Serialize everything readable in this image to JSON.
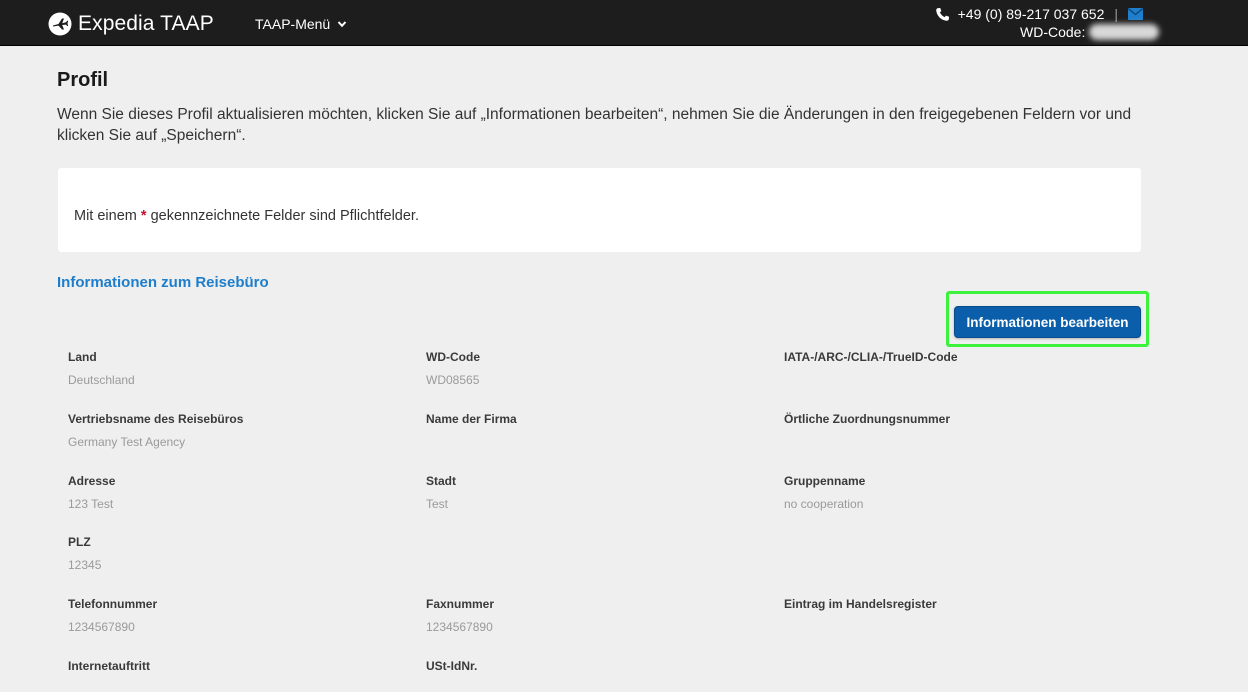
{
  "header": {
    "brand": "Expedia TAAP",
    "menu_label": "TAAP-Menü",
    "phone": "+49 (0) 89-217 037 652",
    "separator": "|",
    "wd_code_label": "WD-Code:"
  },
  "page": {
    "title": "Profil",
    "intro": "Wenn Sie dieses Profil aktualisieren möchten, klicken Sie auf „Informationen bearbeiten“, nehmen Sie die Änderungen in den freigegebenen Feldern vor und klicken Sie auf „Speichern“.",
    "notice_before": "Mit einem ",
    "notice_star": "*",
    "notice_after": " gekennzeichnete Felder sind Pflichtfelder.",
    "section_title": "Informationen zum Reisebüro",
    "edit_button": "Informationen bearbeiten"
  },
  "fields": {
    "land": {
      "label": "Land",
      "value": "Deutschland"
    },
    "wd_code": {
      "label": "WD-Code",
      "value": "WD08565"
    },
    "iata": {
      "label": "IATA-/ARC-/CLIA-/TrueID-Code",
      "value": ""
    },
    "vertriebsname": {
      "label": "Vertriebsname des Reisebüros",
      "value": "Germany Test Agency"
    },
    "firma": {
      "label": "Name der Firma",
      "value": ""
    },
    "zuordnung": {
      "label": "Örtliche Zuordnungsnummer",
      "value": ""
    },
    "adresse": {
      "label": "Adresse",
      "value": "123 Test"
    },
    "stadt": {
      "label": "Stadt",
      "value": "Test"
    },
    "gruppe": {
      "label": "Gruppenname",
      "value": "no cooperation"
    },
    "plz": {
      "label": "PLZ",
      "value": "12345"
    },
    "telefon": {
      "label": "Telefonnummer",
      "value": "1234567890"
    },
    "fax": {
      "label": "Faxnummer",
      "value": "1234567890"
    },
    "handelsregister": {
      "label": "Eintrag im Handelsregister",
      "value": ""
    },
    "internet": {
      "label": "Internetauftritt",
      "value": ""
    },
    "ust": {
      "label": "USt-IdNr.",
      "value": ""
    }
  },
  "colors": {
    "header_bg": "#1d1d1d",
    "page_bg": "#efefef",
    "link_blue": "#1e7ecb",
    "button_blue": "#0a5eaa",
    "highlight_green": "#3df23d",
    "required_red": "#c8102e"
  },
  "icons": {
    "logo": "expedia-plane-icon",
    "menu": "chevron-down-icon",
    "phone": "phone-icon",
    "mail": "mail-icon"
  }
}
